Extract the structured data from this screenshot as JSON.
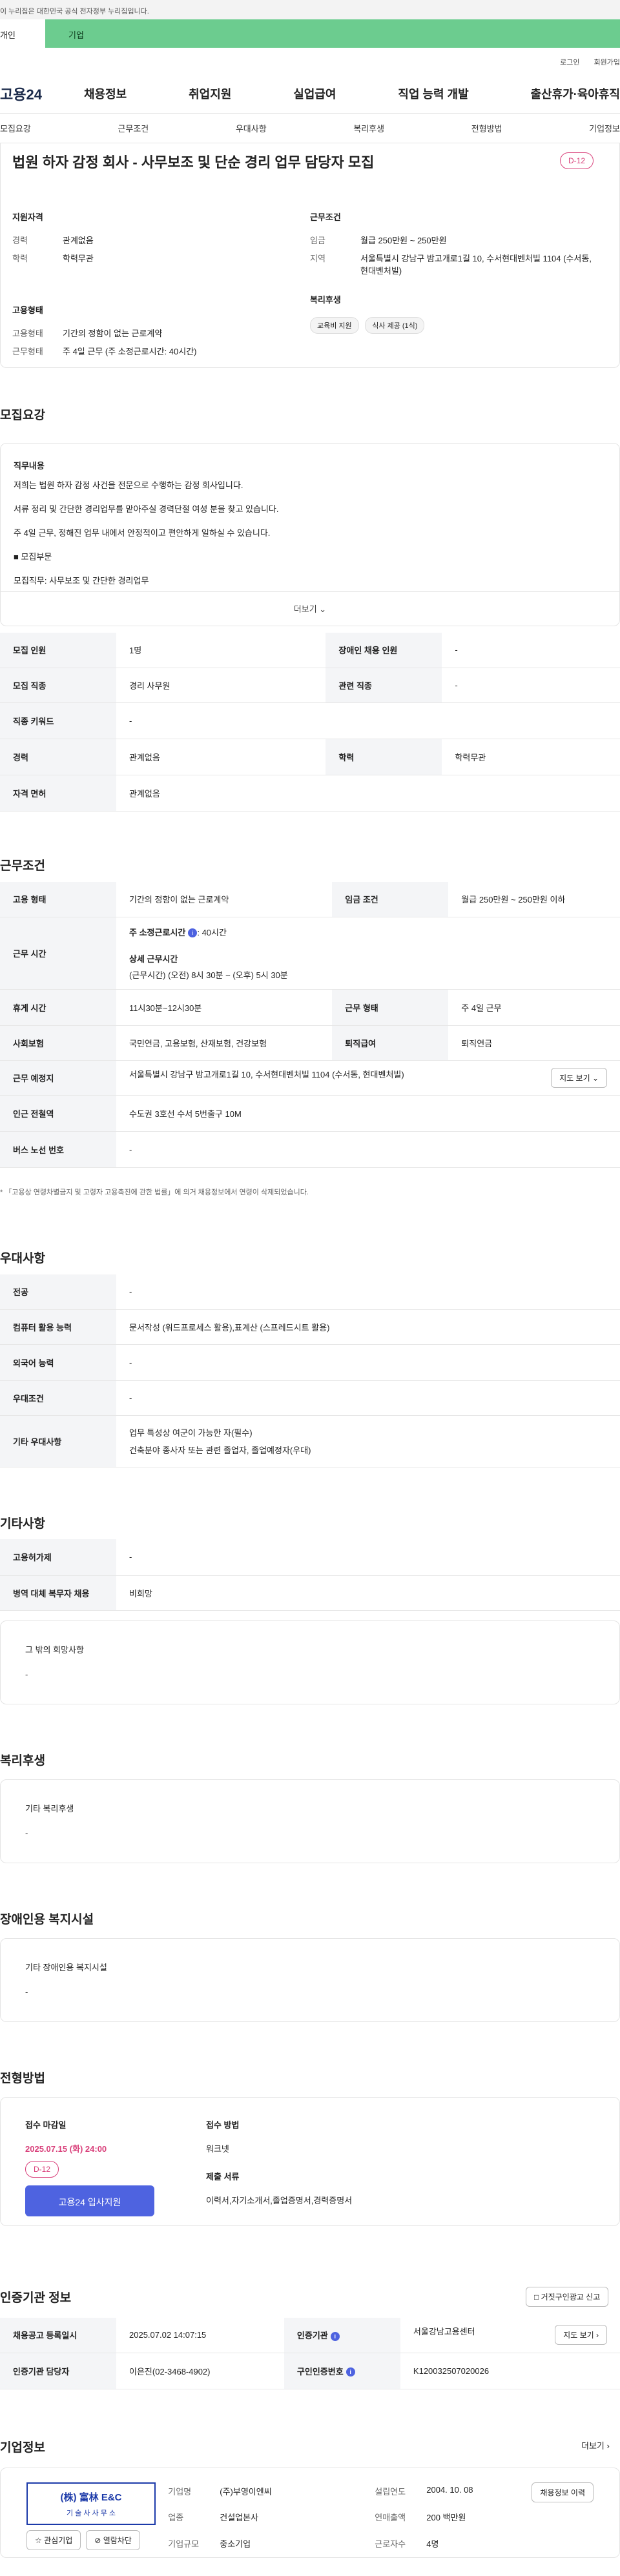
{
  "gov_banner": "이 누리집은 대한민국 공식 전자정부 누리집입니다.",
  "top_tabs": [
    "개인",
    "기업"
  ],
  "utility": [
    "로그인",
    "회원가입"
  ],
  "gnb": {
    "logo": "고용24",
    "menu": [
      "채용정보",
      "취업지원",
      "실업급여",
      "직업 능력 개발",
      "출산휴가·육아휴직"
    ]
  },
  "subnav": [
    "모집요강",
    "근무조건",
    "우대사항",
    "복리후생",
    "전형방법",
    "기업정보"
  ],
  "summary": {
    "title": "법원 하자 감정 회사 - 사무보조 및 단순 경리 업무 담당자 모집",
    "dday": "D-12",
    "qual_title": "지원자격",
    "qual": [
      {
        "k": "경력",
        "v": "관계없음"
      },
      {
        "k": "학력",
        "v": "학력무관"
      }
    ],
    "emp_title": "고용형태",
    "emp": [
      {
        "k": "고용형태",
        "v": "기간의 정함이 없는 근로계약"
      },
      {
        "k": "근무형태",
        "v": "주 4일 근무 (주 소정근로시간: 40시간)"
      }
    ],
    "cond_title": "근무조건",
    "cond": [
      {
        "k": "임금",
        "v": "월급 250만원 ~ 250만원"
      },
      {
        "k": "지역",
        "v": "서울특별시 강남구 밤고개로1길 10, 수서현대벤처빌 1104 (수서동, 현대벤처빌)"
      }
    ],
    "welfare_title": "복리후생",
    "welfare_tags": [
      "교육비 지원",
      "식사 제공 (1식)"
    ]
  },
  "recruit": {
    "title": "모집요강",
    "job_title": "직무내용",
    "lines": [
      "저희는 법원 하자 감정 사건을 전문으로 수행하는 감정 회사입니다.",
      "서류 정리 및 간단한 경리업무를 맡아주실 경력단절 여성 분을 찾고 있습니다.",
      "주 4일 근무, 정해진 업무 내에서 안정적이고 편안하게 일하실 수 있습니다.",
      "■ 모집부문",
      "모집직무: 사무보조 및 간단한 경리업무"
    ],
    "more": "더보기",
    "table": [
      [
        "모집 인원",
        "1명",
        "장애인 채용 인원",
        "-"
      ],
      [
        "모집 직종",
        "경리 사무원",
        "관련 직종",
        "-"
      ],
      [
        "직종 키워드",
        "-",
        "",
        ""
      ],
      [
        "경력",
        "관계없음",
        "학력",
        "학력무관"
      ],
      [
        "자격 면허",
        "관계없음",
        "",
        ""
      ]
    ]
  },
  "conditions": {
    "title": "근무조건",
    "emp_type_k": "고용 형태",
    "emp_type_v": "기간의 정함이 없는 근로계약",
    "wage_k": "임금 조건",
    "wage_v": "월급 250만원 ~ 250만원 이하",
    "hours_k": "근무 시간",
    "hours_week": "주 소정근로시간",
    "hours_week_v": ": 40시간",
    "hours_detail_t": "상세 근무시간",
    "hours_detail_v": "(근무시간) (오전) 8시 30분 ~ (오후) 5시 30분",
    "break_k": "휴게 시간",
    "break_v": "11시30분~12시30분",
    "work_form_k": "근무 형태",
    "work_form_v": "주 4일 근무",
    "insurance_k": "사회보험",
    "insurance_v": "국민연금, 고용보험, 산재보험, 건강보험",
    "retire_k": "퇴직급여",
    "retire_v": "퇴직연금",
    "place_k": "근무 예정지",
    "place_v": "서울특별시 강남구 밤고개로1길 10, 수서현대벤처빌 1104 (수서동, 현대벤처빌)",
    "map_btn": "지도 보기",
    "subway_k": "인근 전철역",
    "subway_v": "수도권 3호선 수서 5번출구 10M",
    "bus_k": "버스 노선 번호",
    "bus_v": "-",
    "note": "* 「고용상 연령차별금지 및 고령자 고용촉진에 관한 법률」에 의거 채용정보에서 연령이 삭제되었습니다."
  },
  "preference": {
    "title": "우대사항",
    "rows": [
      [
        "전공",
        "-"
      ],
      [
        "컴퓨터 활용 능력",
        "문서작성 (워드프로세스 활용),표계산 (스프레드시트 활용)"
      ],
      [
        "외국어 능력",
        "-"
      ],
      [
        "우대조건",
        "-"
      ]
    ],
    "etc_k": "기타 우대사항",
    "etc_v1": "업무 특성상 여군이 가능한 자(필수)",
    "etc_v2": "건축분야 종사자 또는 관련 졸업자, 졸업예정자(우대)"
  },
  "others": {
    "title": "기타사항",
    "rows": [
      [
        "고용허가제",
        "-"
      ],
      [
        "병역 대체 복무자 채용",
        "비희망"
      ]
    ],
    "etc_title": "그 밖의 희망사항",
    "etc_v": "-"
  },
  "welfare": {
    "title": "복리후생",
    "sub": "기타 복리후생",
    "v": "-"
  },
  "disability": {
    "title": "장애인용 복지시설",
    "sub": "기타 장애인용 복지시설",
    "v": "-"
  },
  "process": {
    "title": "전형방법",
    "deadline_t": "접수 마감일",
    "deadline_v": "2025.07.15 (화) 24:00",
    "dday": "D-12",
    "apply_btn": "고용24 입사지원",
    "method_t": "접수 방법",
    "method_v": "워크넷",
    "docs_t": "제출 서류",
    "docs_v": "이력서,자기소개서,졸업증명서,경력증명서"
  },
  "agency": {
    "title": "인증기관 정보",
    "report_btn": "거짓구인광고 신고",
    "reg_k": "채용공고 등록일시",
    "reg_v": "2025.07.02 14:07:15",
    "org_k": "인증기관",
    "org_v": "서울강남고용센터",
    "map_btn": "지도 보기",
    "staff_k": "인증기관 담당자",
    "staff_v": "이은진(02-3468-4902)",
    "num_k": "구인인증번호",
    "num_v": "K120032507020026"
  },
  "company": {
    "title": "기업정보",
    "more": "더보기",
    "logo_text": "(株) 富林 E&C",
    "logo_sub": "기 술 사 사 무 소",
    "btn_fav": "관심기업",
    "btn_block": "열람차단",
    "name_k": "기업명",
    "name_v": "(주)부영이엔씨",
    "est_k": "설립연도",
    "est_v": "2004. 10. 08",
    "ind_k": "업종",
    "ind_v": "건설업본사",
    "sales_k": "연매출액",
    "sales_v": "200 백만원",
    "size_k": "기업규모",
    "size_v": "중소기업",
    "emp_k": "근로자수",
    "emp_v": "4명",
    "jobs_btn": "채용정보 이력"
  }
}
